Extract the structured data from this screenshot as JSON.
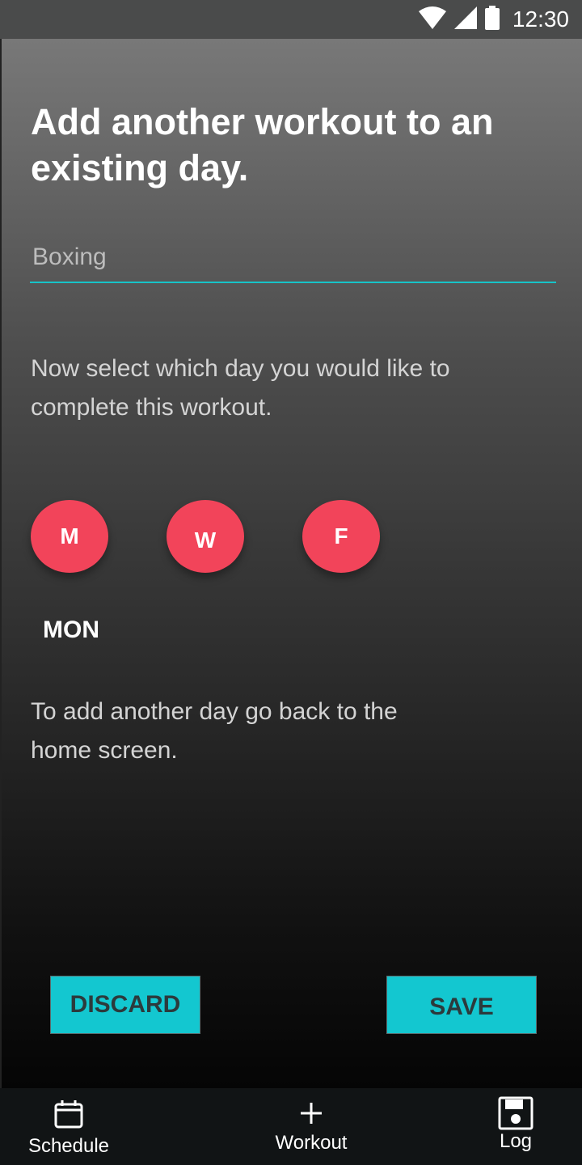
{
  "status_bar": {
    "time": "12:30"
  },
  "page": {
    "title": "Add another workout to an existing day.",
    "workout_input": {
      "value": "",
      "placeholder": "Boxing"
    },
    "instruction": "Now select which day you would like to complete this workout.",
    "days": [
      {
        "label": "M"
      },
      {
        "label": "W"
      },
      {
        "label": "F"
      }
    ],
    "selected_day": "MON",
    "hint": "To add another day go back to the home screen.",
    "discard_label": "DISCARD",
    "save_label": "SAVE"
  },
  "bottom_nav": {
    "items": [
      {
        "label": "Schedule",
        "icon": "calendar-icon"
      },
      {
        "label": "Workout",
        "icon": "plus-icon"
      },
      {
        "label": "Log",
        "icon": "save-icon"
      }
    ]
  },
  "colors": {
    "accent": "#13c7d0",
    "day_button": "#f2445a",
    "input_underline": "#17c3c8"
  }
}
